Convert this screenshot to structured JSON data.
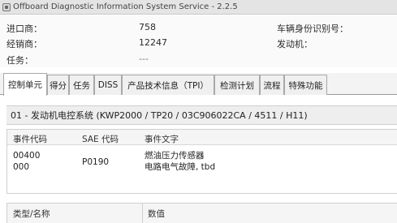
{
  "window": {
    "title": "Offboard Diagnostic Information System Service - 2.2.5",
    "icon": "app-icon"
  },
  "header": {
    "importer_label": "进口商：",
    "importer_value": "758",
    "dealer_label": "经销商：",
    "dealer_value": "12247",
    "task_label": "任务：",
    "task_value": "---",
    "vin_label": "车辆身份识别号：",
    "engine_label": "发动机："
  },
  "tabs": [
    {
      "label": "控制单元",
      "active": true
    },
    {
      "label": "得分",
      "active": false
    },
    {
      "label": "任务",
      "active": false
    },
    {
      "label": "DISS",
      "active": false
    },
    {
      "label": "产品技术信息（TPI）",
      "active": false
    },
    {
      "label": "检测计划",
      "active": false
    },
    {
      "label": "流程",
      "active": false
    },
    {
      "label": "特殊功能",
      "active": false
    }
  ],
  "system": {
    "title": "01 - 发动机电控系统 (KWP2000 / TP20 / 03C906022CA / 4511 / H11)"
  },
  "fault_table": {
    "columns": [
      "事件代码",
      "SAE 代码",
      "事件文字"
    ],
    "rows": [
      {
        "event_code": "00400",
        "event_code_sub": "000",
        "sae_code": "P0190",
        "text_line1": "燃油压力传感器",
        "text_line2": "电路电气故障, tbd"
      }
    ]
  },
  "type_table": {
    "columns": [
      "类型/名称",
      "数值"
    ]
  }
}
